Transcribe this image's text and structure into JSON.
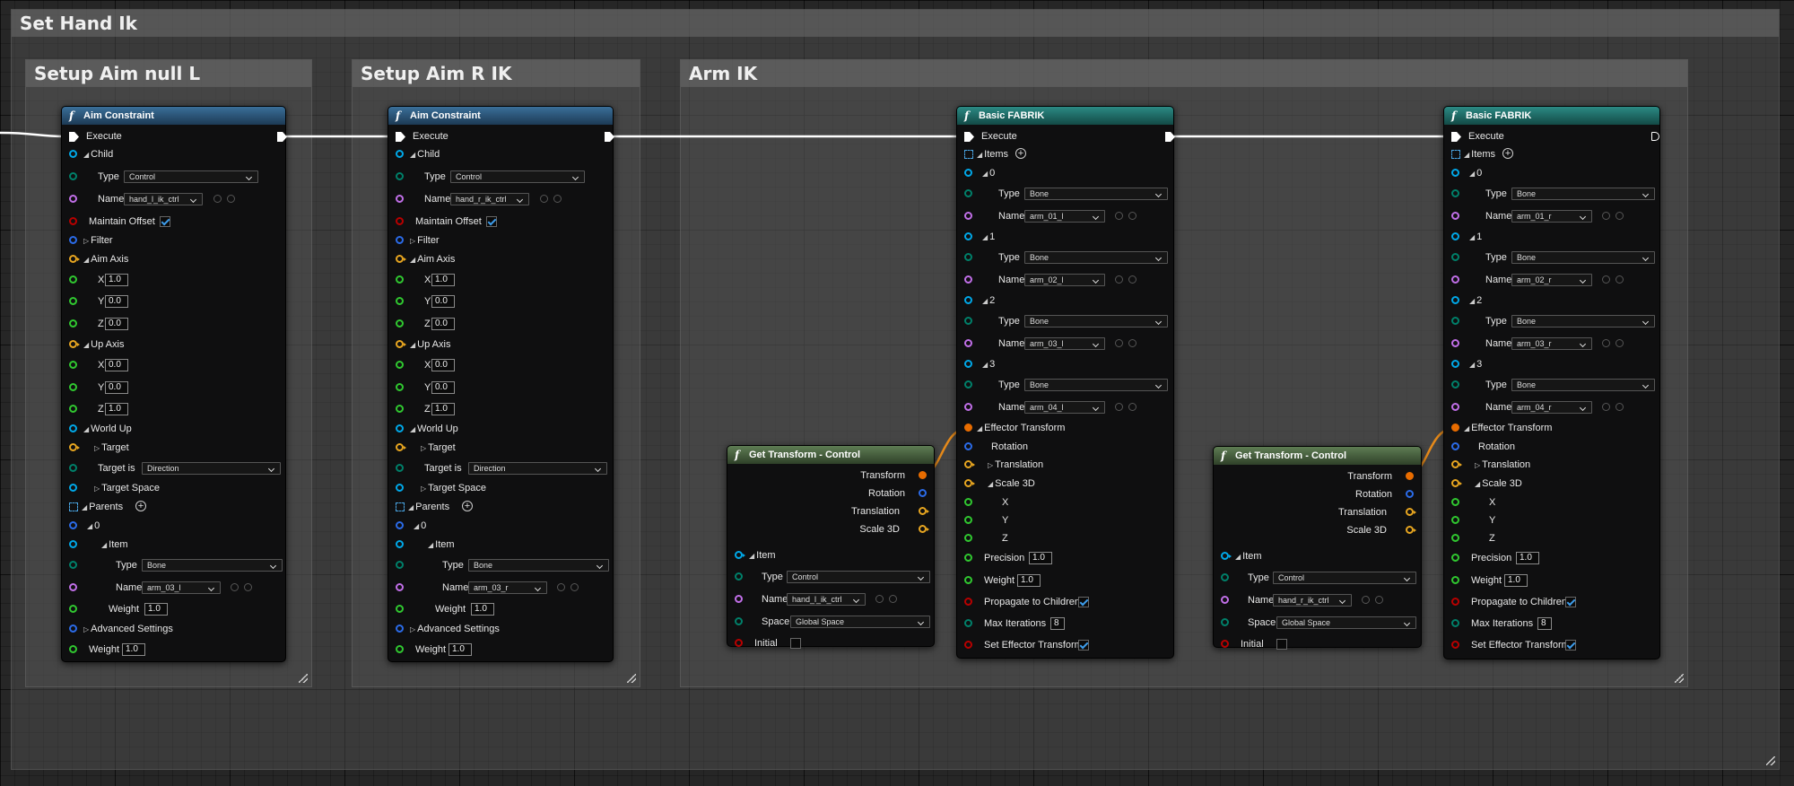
{
  "colors": {
    "exec": "#ffffff",
    "struct": "#00a8e8",
    "name": "#c16fe8",
    "bool": "#b80000",
    "vector": "#e8a620",
    "float": "#30c830",
    "transform": "#e86c00",
    "rotator": "#2b6be8",
    "enum": "#00806a",
    "array": "#00a8e8",
    "wire_transform": "#e68a1a"
  },
  "comments": {
    "set_hand_ik": "Set Hand Ik",
    "setup_aim_null_l": "Setup Aim null L",
    "setup_aim_r_ik": "Setup Aim R IK",
    "arm_ik": "Arm IK"
  },
  "labels": {
    "execute": "Execute",
    "child": "Child",
    "type": "Type",
    "name": "Name",
    "maintain_offset": "Maintain Offset",
    "filter": "Filter",
    "aim_axis": "Aim Axis",
    "up_axis": "Up Axis",
    "x": "X",
    "y": "Y",
    "z": "Z",
    "world_up": "World Up",
    "target": "Target",
    "target_is": "Target is",
    "target_space": "Target Space",
    "parents": "Parents",
    "idx0": "0",
    "idx1": "1",
    "idx2": "2",
    "idx3": "3",
    "item": "Item",
    "items": "Items",
    "weight": "Weight",
    "advanced_settings": "Advanced Settings",
    "effector_transform": "Effector Transform",
    "rotation": "Rotation",
    "translation": "Translation",
    "scale_3d": "Scale 3D",
    "precision": "Precision",
    "propagate_to_children": "Propagate to Children",
    "max_iterations": "Max Iterations",
    "set_effector_transform": "Set Effector Transform",
    "transform": "Transform",
    "space": "Space",
    "initial": "Initial"
  },
  "aim_l": {
    "title": "Aim Constraint",
    "child_type": "Control",
    "child_name": "hand_l_ik_ctrl",
    "maintain_offset": true,
    "aim_x": "1.0",
    "aim_y": "0.0",
    "aim_z": "0.0",
    "up_x": "0.0",
    "up_y": "0.0",
    "up_z": "1.0",
    "target_is": "Direction",
    "parent_type": "Bone",
    "parent_name": "arm_03_l",
    "parent_weight": "1.0",
    "weight": "1.0"
  },
  "aim_r": {
    "title": "Aim Constraint",
    "child_type": "Control",
    "child_name": "hand_r_ik_ctrl",
    "maintain_offset": true,
    "aim_x": "1.0",
    "aim_y": "0.0",
    "aim_z": "0.0",
    "up_x": "0.0",
    "up_y": "0.0",
    "up_z": "1.0",
    "target_is": "Direction",
    "parent_type": "Bone",
    "parent_name": "arm_03_r",
    "parent_weight": "1.0",
    "weight": "1.0"
  },
  "fabrik_l": {
    "title": "Basic FABRIK",
    "items": [
      {
        "type": "Bone",
        "name": "arm_01_l"
      },
      {
        "type": "Bone",
        "name": "arm_02_l"
      },
      {
        "type": "Bone",
        "name": "arm_03_l"
      },
      {
        "type": "Bone",
        "name": "arm_04_l"
      }
    ],
    "precision": "1.0",
    "weight": "1.0",
    "propagate": true,
    "max_iterations": "8",
    "set_effector": true
  },
  "fabrik_r": {
    "title": "Basic FABRIK",
    "items": [
      {
        "type": "Bone",
        "name": "arm_01_r"
      },
      {
        "type": "Bone",
        "name": "arm_02_r"
      },
      {
        "type": "Bone",
        "name": "arm_03_r"
      },
      {
        "type": "Bone",
        "name": "arm_04_r"
      }
    ],
    "precision": "1.0",
    "weight": "1.0",
    "propagate": true,
    "max_iterations": "8",
    "set_effector": true
  },
  "gt_l": {
    "title": "Get Transform - Control",
    "type": "Control",
    "name": "hand_l_ik_ctrl",
    "space": "Global Space",
    "initial": false
  },
  "gt_r": {
    "title": "Get Transform - Control",
    "type": "Control",
    "name": "hand_r_ik_ctrl",
    "space": "Global Space",
    "initial": false
  }
}
